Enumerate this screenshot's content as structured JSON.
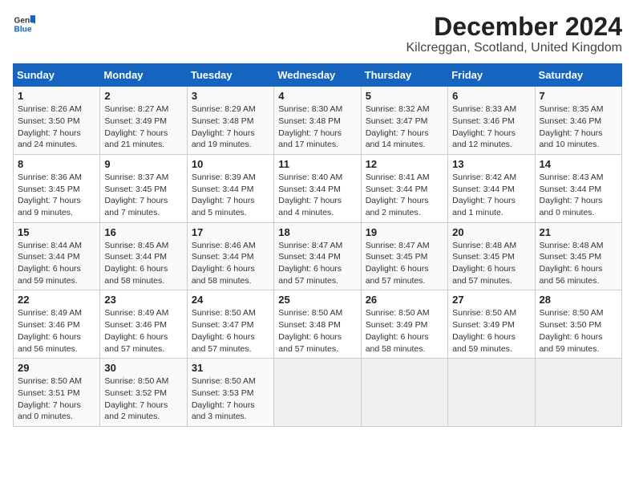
{
  "logo": {
    "line1": "General",
    "line2": "Blue"
  },
  "title": "December 2024",
  "location": "Kilcreggan, Scotland, United Kingdom",
  "weekdays": [
    "Sunday",
    "Monday",
    "Tuesday",
    "Wednesday",
    "Thursday",
    "Friday",
    "Saturday"
  ],
  "weeks": [
    [
      {
        "day": "1",
        "sunrise": "Sunrise: 8:26 AM",
        "sunset": "Sunset: 3:50 PM",
        "daylight": "Daylight: 7 hours and 24 minutes."
      },
      {
        "day": "2",
        "sunrise": "Sunrise: 8:27 AM",
        "sunset": "Sunset: 3:49 PM",
        "daylight": "Daylight: 7 hours and 21 minutes."
      },
      {
        "day": "3",
        "sunrise": "Sunrise: 8:29 AM",
        "sunset": "Sunset: 3:48 PM",
        "daylight": "Daylight: 7 hours and 19 minutes."
      },
      {
        "day": "4",
        "sunrise": "Sunrise: 8:30 AM",
        "sunset": "Sunset: 3:48 PM",
        "daylight": "Daylight: 7 hours and 17 minutes."
      },
      {
        "day": "5",
        "sunrise": "Sunrise: 8:32 AM",
        "sunset": "Sunset: 3:47 PM",
        "daylight": "Daylight: 7 hours and 14 minutes."
      },
      {
        "day": "6",
        "sunrise": "Sunrise: 8:33 AM",
        "sunset": "Sunset: 3:46 PM",
        "daylight": "Daylight: 7 hours and 12 minutes."
      },
      {
        "day": "7",
        "sunrise": "Sunrise: 8:35 AM",
        "sunset": "Sunset: 3:46 PM",
        "daylight": "Daylight: 7 hours and 10 minutes."
      }
    ],
    [
      {
        "day": "8",
        "sunrise": "Sunrise: 8:36 AM",
        "sunset": "Sunset: 3:45 PM",
        "daylight": "Daylight: 7 hours and 9 minutes."
      },
      {
        "day": "9",
        "sunrise": "Sunrise: 8:37 AM",
        "sunset": "Sunset: 3:45 PM",
        "daylight": "Daylight: 7 hours and 7 minutes."
      },
      {
        "day": "10",
        "sunrise": "Sunrise: 8:39 AM",
        "sunset": "Sunset: 3:44 PM",
        "daylight": "Daylight: 7 hours and 5 minutes."
      },
      {
        "day": "11",
        "sunrise": "Sunrise: 8:40 AM",
        "sunset": "Sunset: 3:44 PM",
        "daylight": "Daylight: 7 hours and 4 minutes."
      },
      {
        "day": "12",
        "sunrise": "Sunrise: 8:41 AM",
        "sunset": "Sunset: 3:44 PM",
        "daylight": "Daylight: 7 hours and 2 minutes."
      },
      {
        "day": "13",
        "sunrise": "Sunrise: 8:42 AM",
        "sunset": "Sunset: 3:44 PM",
        "daylight": "Daylight: 7 hours and 1 minute."
      },
      {
        "day": "14",
        "sunrise": "Sunrise: 8:43 AM",
        "sunset": "Sunset: 3:44 PM",
        "daylight": "Daylight: 7 hours and 0 minutes."
      }
    ],
    [
      {
        "day": "15",
        "sunrise": "Sunrise: 8:44 AM",
        "sunset": "Sunset: 3:44 PM",
        "daylight": "Daylight: 6 hours and 59 minutes."
      },
      {
        "day": "16",
        "sunrise": "Sunrise: 8:45 AM",
        "sunset": "Sunset: 3:44 PM",
        "daylight": "Daylight: 6 hours and 58 minutes."
      },
      {
        "day": "17",
        "sunrise": "Sunrise: 8:46 AM",
        "sunset": "Sunset: 3:44 PM",
        "daylight": "Daylight: 6 hours and 58 minutes."
      },
      {
        "day": "18",
        "sunrise": "Sunrise: 8:47 AM",
        "sunset": "Sunset: 3:44 PM",
        "daylight": "Daylight: 6 hours and 57 minutes."
      },
      {
        "day": "19",
        "sunrise": "Sunrise: 8:47 AM",
        "sunset": "Sunset: 3:45 PM",
        "daylight": "Daylight: 6 hours and 57 minutes."
      },
      {
        "day": "20",
        "sunrise": "Sunrise: 8:48 AM",
        "sunset": "Sunset: 3:45 PM",
        "daylight": "Daylight: 6 hours and 57 minutes."
      },
      {
        "day": "21",
        "sunrise": "Sunrise: 8:48 AM",
        "sunset": "Sunset: 3:45 PM",
        "daylight": "Daylight: 6 hours and 56 minutes."
      }
    ],
    [
      {
        "day": "22",
        "sunrise": "Sunrise: 8:49 AM",
        "sunset": "Sunset: 3:46 PM",
        "daylight": "Daylight: 6 hours and 56 minutes."
      },
      {
        "day": "23",
        "sunrise": "Sunrise: 8:49 AM",
        "sunset": "Sunset: 3:46 PM",
        "daylight": "Daylight: 6 hours and 57 minutes."
      },
      {
        "day": "24",
        "sunrise": "Sunrise: 8:50 AM",
        "sunset": "Sunset: 3:47 PM",
        "daylight": "Daylight: 6 hours and 57 minutes."
      },
      {
        "day": "25",
        "sunrise": "Sunrise: 8:50 AM",
        "sunset": "Sunset: 3:48 PM",
        "daylight": "Daylight: 6 hours and 57 minutes."
      },
      {
        "day": "26",
        "sunrise": "Sunrise: 8:50 AM",
        "sunset": "Sunset: 3:49 PM",
        "daylight": "Daylight: 6 hours and 58 minutes."
      },
      {
        "day": "27",
        "sunrise": "Sunrise: 8:50 AM",
        "sunset": "Sunset: 3:49 PM",
        "daylight": "Daylight: 6 hours and 59 minutes."
      },
      {
        "day": "28",
        "sunrise": "Sunrise: 8:50 AM",
        "sunset": "Sunset: 3:50 PM",
        "daylight": "Daylight: 6 hours and 59 minutes."
      }
    ],
    [
      {
        "day": "29",
        "sunrise": "Sunrise: 8:50 AM",
        "sunset": "Sunset: 3:51 PM",
        "daylight": "Daylight: 7 hours and 0 minutes."
      },
      {
        "day": "30",
        "sunrise": "Sunrise: 8:50 AM",
        "sunset": "Sunset: 3:52 PM",
        "daylight": "Daylight: 7 hours and 2 minutes."
      },
      {
        "day": "31",
        "sunrise": "Sunrise: 8:50 AM",
        "sunset": "Sunset: 3:53 PM",
        "daylight": "Daylight: 7 hours and 3 minutes."
      },
      null,
      null,
      null,
      null
    ]
  ]
}
